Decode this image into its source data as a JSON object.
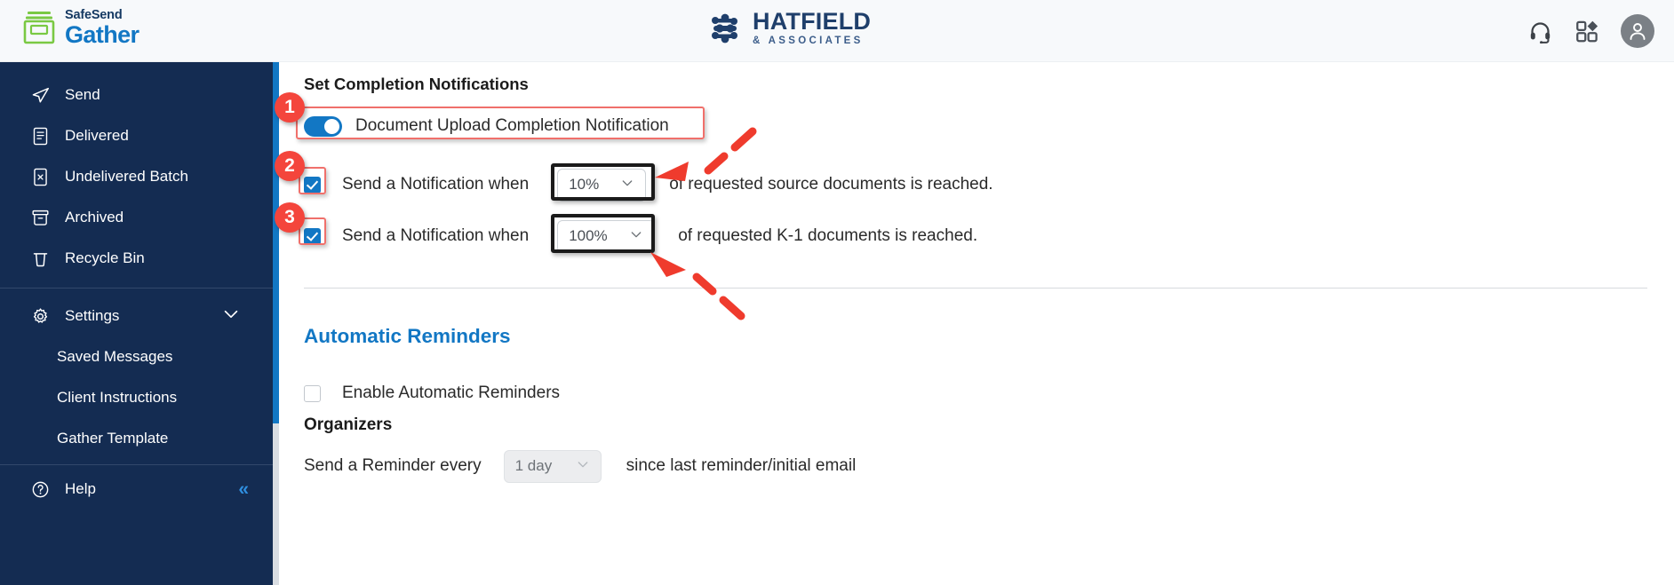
{
  "topbar": {
    "product_brand_top": "SafeSend",
    "product_brand_bottom": "Gather",
    "firm_name": "HATFIELD",
    "firm_subtitle": "& ASSOCIATES",
    "support_icon": "headset-icon",
    "apps_icon": "apps-grid-icon",
    "avatar_icon": "user-avatar-icon",
    "background": "#f7f9fb"
  },
  "sidebar": {
    "background": "#142c52",
    "items": [
      {
        "label": "Send",
        "icon": "send-paper-plane-icon"
      },
      {
        "label": "Delivered",
        "icon": "document-lines-icon"
      },
      {
        "label": "Undelivered Batch",
        "icon": "document-x-icon"
      },
      {
        "label": "Archived",
        "icon": "archive-box-icon"
      },
      {
        "label": "Recycle Bin",
        "icon": "trash-bin-icon"
      }
    ],
    "settings": {
      "label": "Settings",
      "icon": "gear-icon",
      "chevron": "chevron-down-icon"
    },
    "sub_items": [
      {
        "label": "Saved Messages"
      },
      {
        "label": "Client Instructions"
      },
      {
        "label": "Gather Template"
      }
    ],
    "help": {
      "label": "Help",
      "icon": "question-circle-icon",
      "collapse": "«",
      "collapse_color": "#2f8fe0"
    }
  },
  "main": {
    "section_title": "Set Completion Notifications",
    "toggle_row": {
      "label": "Document Upload Completion Notification",
      "toggle_state": "on",
      "toggle_color": "#1277c4"
    },
    "notification_rows": [
      {
        "checked": true,
        "lead_text": "Send a Notification when",
        "value": "10%",
        "tail_text": "of requested source documents is reached.",
        "chevron": "chevron-down-icon"
      },
      {
        "checked": true,
        "lead_text": "Send a Notification when",
        "value": "100%",
        "tail_text": "of requested K-1 documents is reached.",
        "chevron": "chevron-down-icon"
      }
    ],
    "automatic_reminders": {
      "heading": "Automatic Reminders",
      "heading_color": "#1277c4",
      "enable_label": "Enable Automatic Reminders",
      "enable_checked": false,
      "organizers_label": "Organizers",
      "reminder_lead": "Send a Reminder every",
      "reminder_value": "1 day",
      "reminder_tail": "since last reminder/initial email",
      "reminder_disabled": true
    }
  },
  "annotations": {
    "badge_color": "#f4453c",
    "highlight_red": "#f0706b",
    "highlight_black": "#1a1a1a",
    "badges": [
      {
        "number": "1"
      },
      {
        "number": "2"
      },
      {
        "number": "3"
      }
    ],
    "arrows": [
      {
        "name": "arrow-to-10-percent-dropdown"
      },
      {
        "name": "arrow-to-100-percent-dropdown"
      }
    ]
  }
}
